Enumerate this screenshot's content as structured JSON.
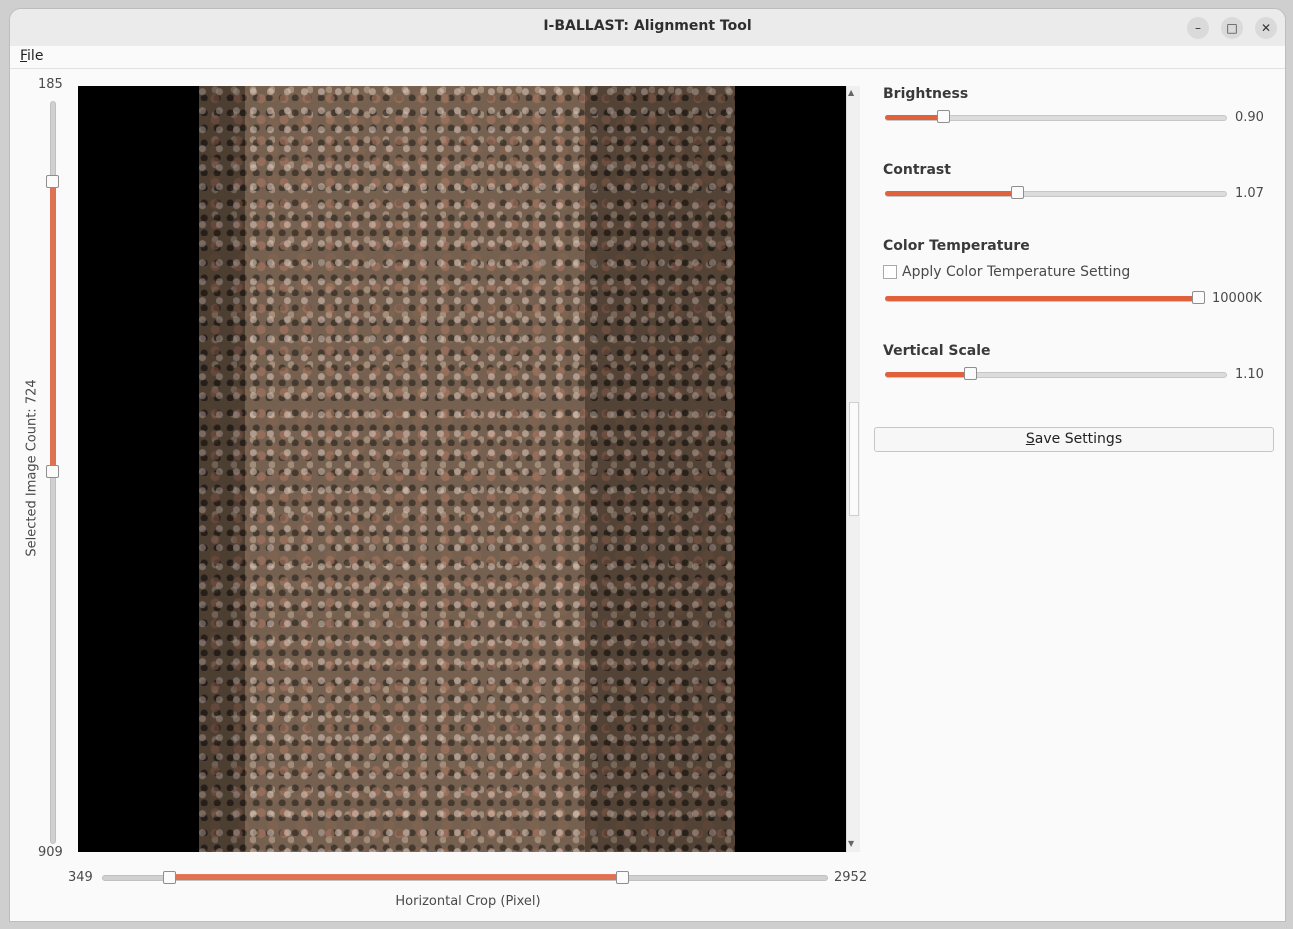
{
  "window": {
    "title": "I-BALLAST: Alignment Tool",
    "controls": {
      "minimize": "–",
      "maximize": "□",
      "close": "✕"
    }
  },
  "menu": {
    "file": {
      "accel": "F",
      "rest": "ile"
    }
  },
  "left_panel": {
    "top_value": "185",
    "bottom_value": "909",
    "label": "Selected Image Count: 724"
  },
  "crop": {
    "min_label": "349",
    "max_label": "2952",
    "label": "Horizontal Crop (Pixel)"
  },
  "brightness": {
    "title": "Brightness",
    "value": "0.90"
  },
  "contrast": {
    "title": "Contrast",
    "value": "1.07"
  },
  "color_temp": {
    "title": "Color Temperature",
    "checkbox_label": "Apply Color Temperature Setting",
    "checked": false,
    "value": "10000K"
  },
  "vertical_scale": {
    "title": "Vertical Scale",
    "value": "1.10"
  },
  "save": {
    "accel": "S",
    "rest": "ave Settings"
  },
  "colors": {
    "accent": "#e0623c",
    "viewer_bg": "#000000"
  }
}
